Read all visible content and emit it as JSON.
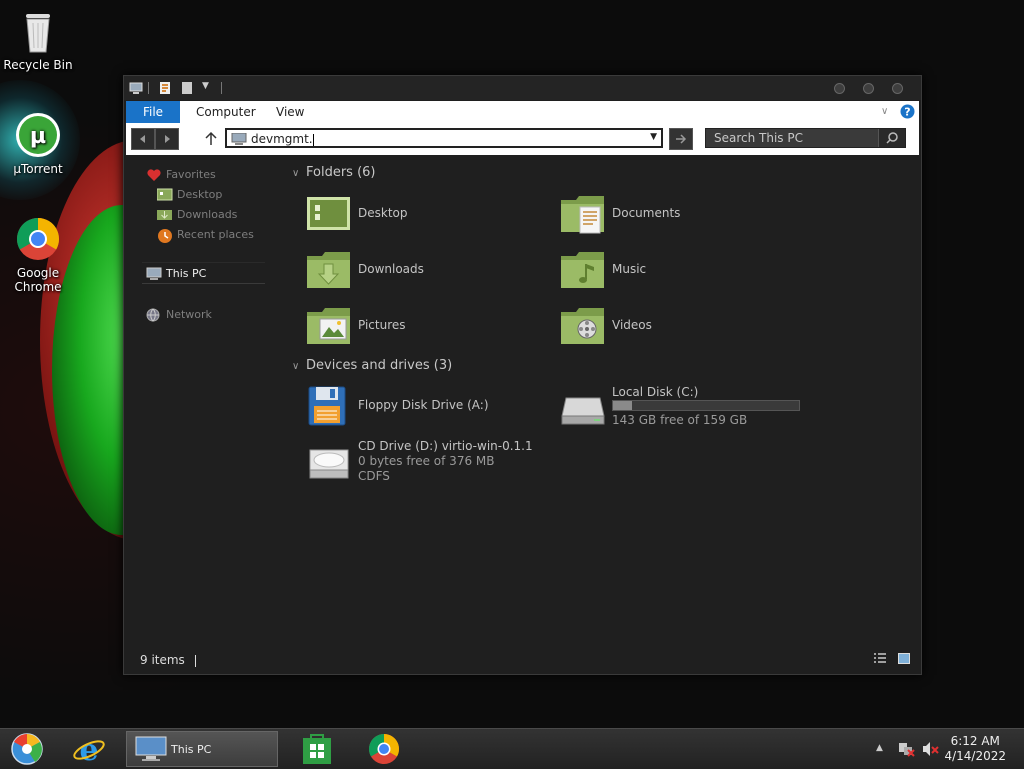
{
  "desktop": {
    "icons": [
      {
        "label": "Recycle Bin",
        "icon": "recycle-bin-icon"
      },
      {
        "label": "µTorrent",
        "icon": "utorrent-icon"
      },
      {
        "label": "Google Chrome",
        "icon": "chrome-icon"
      }
    ]
  },
  "ribbon": {
    "tabs": [
      {
        "label": "File"
      },
      {
        "label": "Computer"
      },
      {
        "label": "View"
      }
    ]
  },
  "address_bar": {
    "value": "devmgmt."
  },
  "search": {
    "placeholder": "Search This PC"
  },
  "nav_pane": {
    "favorites": "Favorites",
    "items": [
      "Desktop",
      "Downloads",
      "Recent places"
    ],
    "this_pc": "This PC",
    "network": "Network"
  },
  "content": {
    "folders_header": "Folders (6)",
    "folders": [
      {
        "label": "Desktop",
        "icon": "desktop-folder-icon"
      },
      {
        "label": "Documents",
        "icon": "documents-folder-icon"
      },
      {
        "label": "Downloads",
        "icon": "downloads-folder-icon"
      },
      {
        "label": "Music",
        "icon": "music-folder-icon"
      },
      {
        "label": "Pictures",
        "icon": "pictures-folder-icon"
      },
      {
        "label": "Videos",
        "icon": "videos-folder-icon"
      }
    ],
    "devices_header": "Devices and drives (3)",
    "floppy": {
      "label": "Floppy Disk Drive (A:)"
    },
    "local_disk": {
      "label": "Local Disk (C:)",
      "free": "143 GB free of 159 GB",
      "used_fraction": 0.1
    },
    "cd_drive": {
      "label": "CD Drive (D:) virtio-win-0.1.1",
      "free": "0 bytes free of 376 MB",
      "fs": "CDFS"
    }
  },
  "status": {
    "items": "9 items"
  },
  "taskbar": {
    "window_label": "This PC",
    "time": "6:12 AM",
    "date": "4/14/2022"
  },
  "colors": {
    "accent": "#1a73c8",
    "folder_green": "#8aa85a"
  }
}
